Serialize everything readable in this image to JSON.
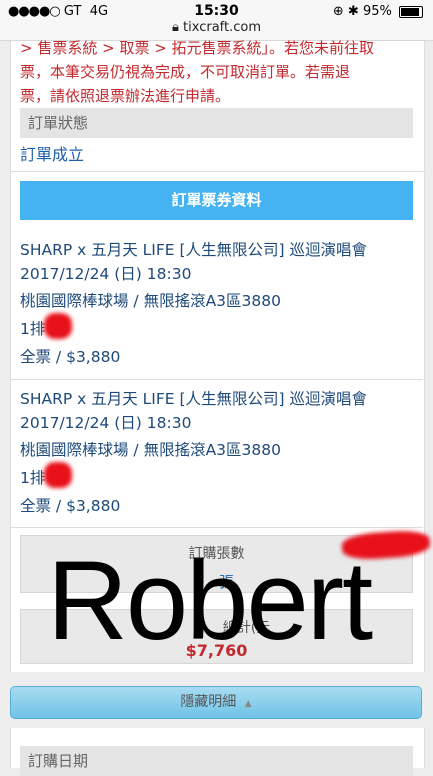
{
  "status_bar": {
    "carrier": "GT",
    "network": "4G",
    "time": "15:30",
    "url": "tixcraft.com",
    "battery": "95%",
    "lock_icon": "lock-icon"
  },
  "notice": {
    "line1": "> 售票系統 > 取票 > 拓元售票系統」。若您未前往取",
    "line2": "票，本筆交易仍視為完成，不可取消訂單。若需退",
    "line3": "票，請依照退票辦法進行申請。"
  },
  "order_status": {
    "label": "訂單狀態",
    "value": "訂單成立"
  },
  "tickets_section": {
    "title": "訂單票券資料",
    "tickets": [
      {
        "event": "SHARP x 五月天 LIFE [人生無限公司] 巡迴演唱會",
        "datetime": "2017/12/24 (日) 18:30",
        "venue": "桃園國際棒球場 / 無限搖滾A3區3880",
        "seat": "1排 號",
        "price": "全票 / $3,880"
      },
      {
        "event": "SHARP x 五月天 LIFE [人生無限公司] 巡迴演唱會",
        "datetime": "2017/12/24 (日) 18:30",
        "venue": "桃園國際棒球場 / 無限搖滾A3區3880",
        "seat": "1排 號",
        "price": "全票 / $3,880"
      }
    ]
  },
  "summary": {
    "qty_label": "訂購張數",
    "qty_value": "張",
    "total_label": "總計(元",
    "total_value": "$7,760"
  },
  "toggle_button": {
    "label": "隱藏明細",
    "icon": "triangle-up-icon"
  },
  "order_date": {
    "label": "訂購日期"
  },
  "overlay_text": "Robert"
}
